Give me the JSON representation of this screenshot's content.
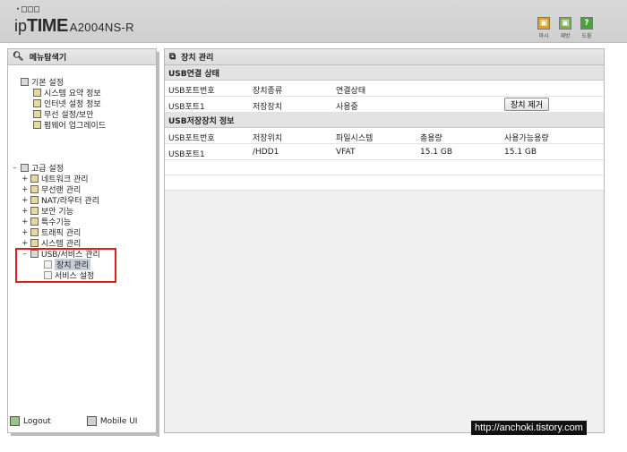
{
  "header": {
    "logo_top": "·□□□",
    "logo_ip": "ip",
    "logo_time": "TIME",
    "model": "A2004NS-R",
    "icons": [
      {
        "name": "wizard-icon",
        "label": "마시",
        "color": "#e0a020"
      },
      {
        "name": "window-icon",
        "label": "재방",
        "color": "#7fb050"
      },
      {
        "name": "help-icon",
        "label": "도움",
        "color": "#4aa040",
        "glyph": "?"
      }
    ]
  },
  "menu": {
    "title": "메뉴탐색기",
    "basic": {
      "label": "기본 설정",
      "items": [
        "시스템 요약 정보",
        "인터넷 설정 정보",
        "무선 설정/보안",
        "펌웨어 업그레이드"
      ]
    },
    "advanced": {
      "label": "고급 설정",
      "items": [
        "네트워크 관리",
        "무선랜 관리",
        "NAT/라우터 관리",
        "보안 기능",
        "특수기능",
        "트래픽 관리",
        "시스템 관리",
        "USB/서비스 관리"
      ],
      "usb_children": [
        "장치 관리",
        "서비스 설정"
      ]
    },
    "logout": "Logout",
    "mobile": "Mobile UI"
  },
  "main": {
    "title": "장치 관리",
    "usb_connect": {
      "heading": "USB연결 상태",
      "columns": [
        "USB포트번호",
        "장치종류",
        "연결상태"
      ],
      "rows": [
        [
          "USB포트1",
          "저장장치",
          "사용중"
        ]
      ],
      "remove_button": "장치 제거"
    },
    "usb_storage": {
      "heading": "USB저장장치 정보",
      "columns": [
        "USB포트번호",
        "저장위치",
        "파일시스템",
        "총용량",
        "사용가능용량"
      ],
      "rows": [
        [
          "USB포트1",
          "/HDD1",
          "VFAT",
          "15.1 GB",
          "15.1 GB"
        ]
      ]
    }
  },
  "watermark": "http://anchoki.tistory.com"
}
